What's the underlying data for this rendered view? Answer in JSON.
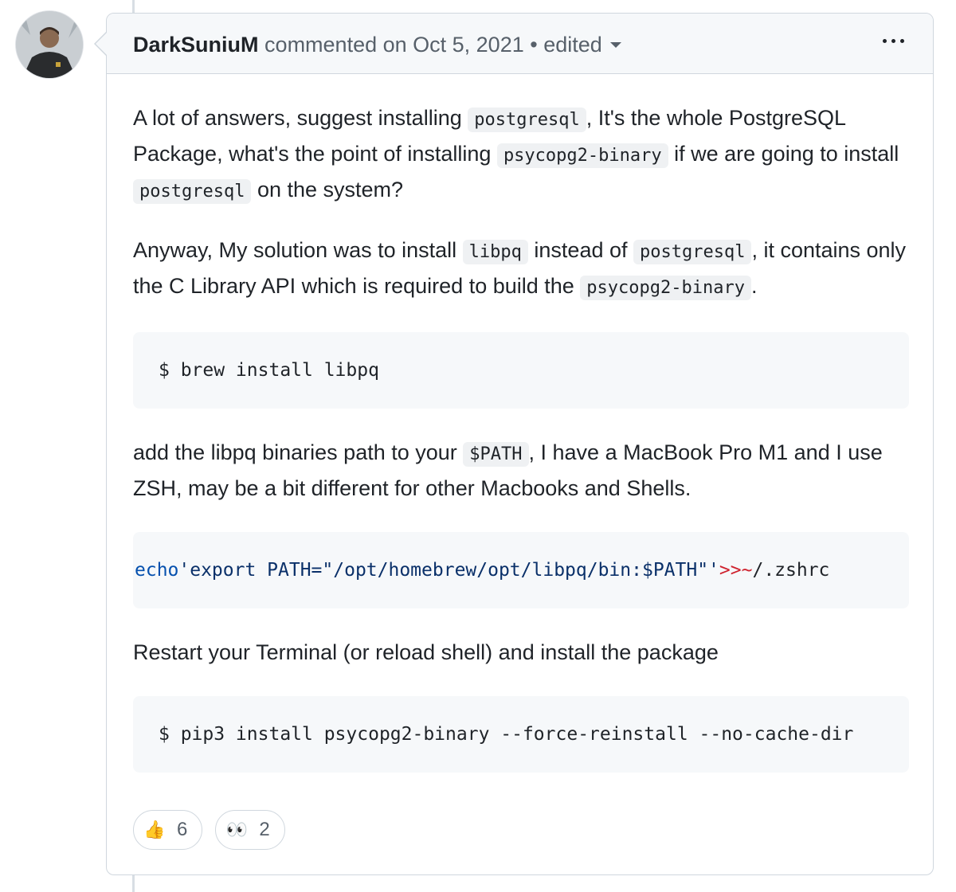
{
  "comment": {
    "author": "DarkSuniuM",
    "action_text": "commented on Oct 5, 2021",
    "separator": "•",
    "edited_label": "edited"
  },
  "body": {
    "p1": {
      "t1": "A lot of answers, suggest installing ",
      "c1": "postgresql",
      "t2": ", It's the whole PostgreSQL Package, what's the point of installing ",
      "c2": "psycopg2-binary",
      "t3": " if we are going to install ",
      "c3": "postgresql",
      "t4": " on the system?"
    },
    "p2": {
      "t1": "Anyway, My solution was to install ",
      "c1": "libpq",
      "t2": " instead of ",
      "c2": "postgresql",
      "t3": ", it contains only the C Library API which is required to build the ",
      "c3": "psycopg2-binary",
      "t4": "."
    },
    "code1": "$ brew install libpq",
    "p3": {
      "t1": "add the libpq binaries path to your ",
      "c1": "$PATH",
      "t2": ", I have a MacBook Pro M1 and I use ZSH, may be a bit different for other Macbooks and Shells."
    },
    "code2": {
      "kw": "echo",
      "str": "'export PATH=\"/opt/homebrew/opt/libpq/bin:$PATH\"'",
      "op1": ">>",
      "op2": "~",
      "rest": "/.zshrc"
    },
    "p4": "Restart your Terminal (or reload shell) and install the package",
    "code3": "$ pip3 install psycopg2-binary --force-reinstall --no-cache-dir"
  },
  "reactions": [
    {
      "icon": "thumbs-up",
      "glyph": "👍",
      "count": "6"
    },
    {
      "icon": "eyes",
      "glyph": "👀",
      "count": "2"
    }
  ]
}
